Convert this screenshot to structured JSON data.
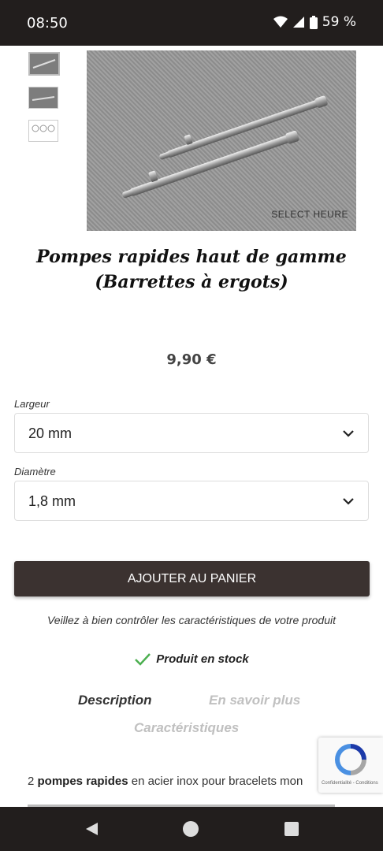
{
  "status_bar": {
    "time": "08:50",
    "battery": "59 %"
  },
  "gallery": {
    "watermark": "SELECT HEURE"
  },
  "product": {
    "title_line1": "Pompes rapides haut de gamme",
    "title_line2": "(Barrettes à ergots)",
    "price": "9,90 €"
  },
  "options": {
    "width_label": "Largeur",
    "width_value": "20 mm",
    "diameter_label": "Diamètre",
    "diameter_value": "1,8 mm"
  },
  "cart": {
    "add_button": "AJOUTER AU PANIER"
  },
  "notice": "Veillez à bien contrôler les caractéristiques de votre produit",
  "stock": "Produit en stock",
  "tabs": {
    "description": "Description",
    "more": "En savoir plus",
    "specs": "Caractéristiques"
  },
  "description": {
    "prefix": "2 ",
    "bold": "pompes rapides",
    "rest": " en acier inox pour bracelets mon"
  },
  "recaptcha": {
    "links": "Confidentialité - Conditions"
  },
  "colors": {
    "bar": "#221e1d",
    "button": "#3b3230",
    "check": "#4caf50"
  }
}
